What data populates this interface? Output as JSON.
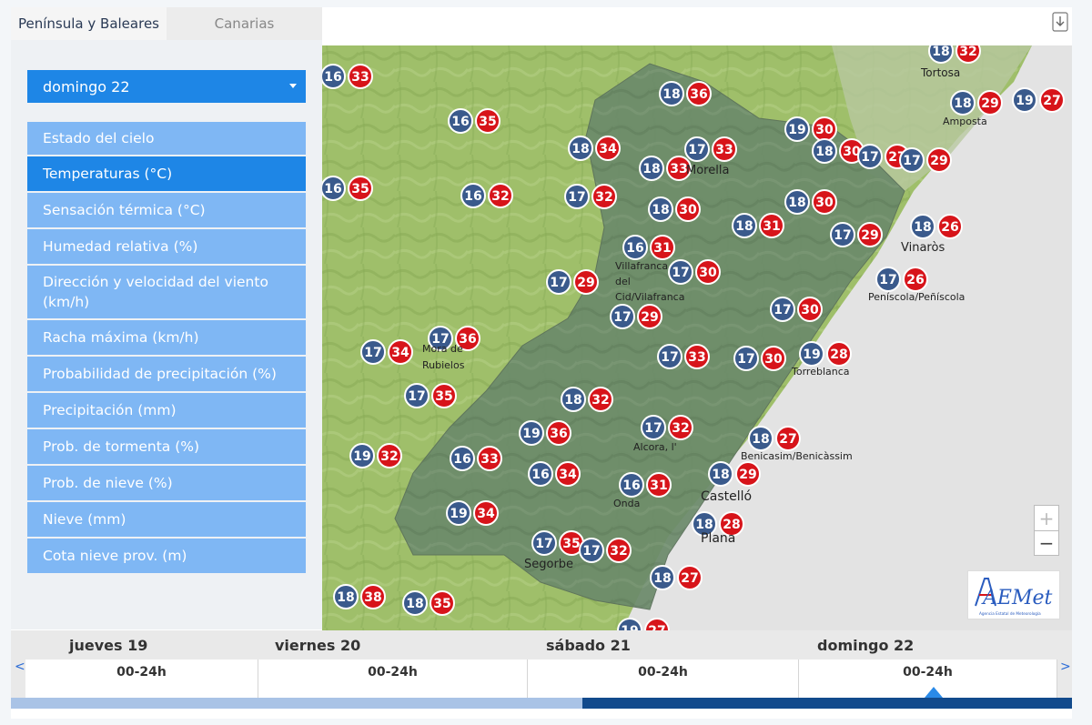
{
  "tabs": [
    {
      "label": "Península y Baleares",
      "active": true
    },
    {
      "label": "Canarias",
      "active": false
    }
  ],
  "day_select": {
    "value": "domingo 22"
  },
  "menu": [
    {
      "label": "Estado del cielo",
      "active": false
    },
    {
      "label": "Temperaturas (°C)",
      "active": true
    },
    {
      "label": "Sensación térmica (°C)",
      "active": false
    },
    {
      "label": "Humedad relativa (%)",
      "active": false
    },
    {
      "label": "Dirección y velocidad del viento (km/h)",
      "active": false
    },
    {
      "label": "Racha máxima (km/h)",
      "active": false
    },
    {
      "label": "Probabilidad de precipitación (%)",
      "active": false
    },
    {
      "label": "Precipitación (mm)",
      "active": false
    },
    {
      "label": "Prob. de tormenta (%)",
      "active": false
    },
    {
      "label": "Prob. de nieve (%)",
      "active": false
    },
    {
      "label": "Nieve (mm)",
      "active": false
    },
    {
      "label": "Cota nieve prov. (m)",
      "active": false
    }
  ],
  "timeline": {
    "days": [
      {
        "name": "jueves 19",
        "slot": "00-24h"
      },
      {
        "name": "viernes 20",
        "slot": "00-24h"
      },
      {
        "name": "sábado 21",
        "slot": "00-24h"
      },
      {
        "name": "domingo 22",
        "slot": "00-24h"
      }
    ],
    "prev": "<",
    "next": ">"
  },
  "zoom": {
    "plus": "+",
    "minus": "−"
  },
  "colors": {
    "min_marker": "#3a5a8c",
    "max_marker": "#d7141a",
    "accent": "#1e86e6",
    "menu": "#7fb7f4"
  },
  "icons": {
    "download": "download-icon",
    "logo": "aemet-logo"
  },
  "logo": {
    "text": "AEMet",
    "subtitle": "Agencia Estatal de Meteorología"
  },
  "places": [
    {
      "name": "Tortosa"
    },
    {
      "name": "Amposta"
    },
    {
      "name": "Morella"
    },
    {
      "name": "Vinaròs"
    },
    {
      "name": "Villafranca del Cid/Vilafranca"
    },
    {
      "name": "Peníscola/Peñíscola"
    },
    {
      "name": "Mora de Rubielos"
    },
    {
      "name": "Torreblanca"
    },
    {
      "name": "Alcora, l'"
    },
    {
      "name": "Benicasim/Benicàssim"
    },
    {
      "name": "Onda"
    },
    {
      "name": "Castelló"
    },
    {
      "name": "Plana"
    },
    {
      "name": "Segorbe"
    }
  ],
  "markers": [
    {
      "min": 18,
      "max": 32
    },
    {
      "min": 16,
      "max": 33
    },
    {
      "min": 18,
      "max": 36
    },
    {
      "min": 18,
      "max": 29
    },
    {
      "min": 19,
      "max": 27
    },
    {
      "min": 16,
      "max": 35
    },
    {
      "min": 19,
      "max": 30
    },
    {
      "min": 18,
      "max": 34
    },
    {
      "min": 17,
      "max": 33
    },
    {
      "min": 18,
      "max": 33
    },
    {
      "min": 18,
      "max": 30
    },
    {
      "min": 17,
      "max": 27
    },
    {
      "min": 17,
      "max": 29
    },
    {
      "min": 16,
      "max": 35
    },
    {
      "min": 16,
      "max": 32
    },
    {
      "min": 17,
      "max": 32
    },
    {
      "min": 18,
      "max": 30
    },
    {
      "min": 18,
      "max": 31
    },
    {
      "min": 18,
      "max": 30
    },
    {
      "min": 17,
      "max": 29
    },
    {
      "min": 18,
      "max": 26
    },
    {
      "min": 16,
      "max": 31
    },
    {
      "min": 17,
      "max": 30
    },
    {
      "min": 17,
      "max": 29
    },
    {
      "min": 17,
      "max": 26
    },
    {
      "min": 17,
      "max": 29
    },
    {
      "min": 17,
      "max": 30
    },
    {
      "min": 17,
      "max": 34
    },
    {
      "min": 17,
      "max": 36
    },
    {
      "min": 17,
      "max": 33
    },
    {
      "min": 17,
      "max": 30
    },
    {
      "min": 19,
      "max": 28
    },
    {
      "min": 17,
      "max": 35
    },
    {
      "min": 18,
      "max": 32
    },
    {
      "min": 19,
      "max": 36
    },
    {
      "min": 17,
      "max": 32
    },
    {
      "min": 18,
      "max": 27
    },
    {
      "min": 19,
      "max": 32
    },
    {
      "min": 16,
      "max": 33
    },
    {
      "min": 16,
      "max": 34
    },
    {
      "min": 16,
      "max": 31
    },
    {
      "min": 18,
      "max": 29
    },
    {
      "min": 19,
      "max": 34
    },
    {
      "min": 18,
      "max": 28
    },
    {
      "min": 17,
      "max": 35
    },
    {
      "min": 17,
      "max": 32
    },
    {
      "min": 18,
      "max": 27
    },
    {
      "min": 18,
      "max": 38
    },
    {
      "min": 18,
      "max": 35
    },
    {
      "min": 19,
      "max": 27
    }
  ]
}
